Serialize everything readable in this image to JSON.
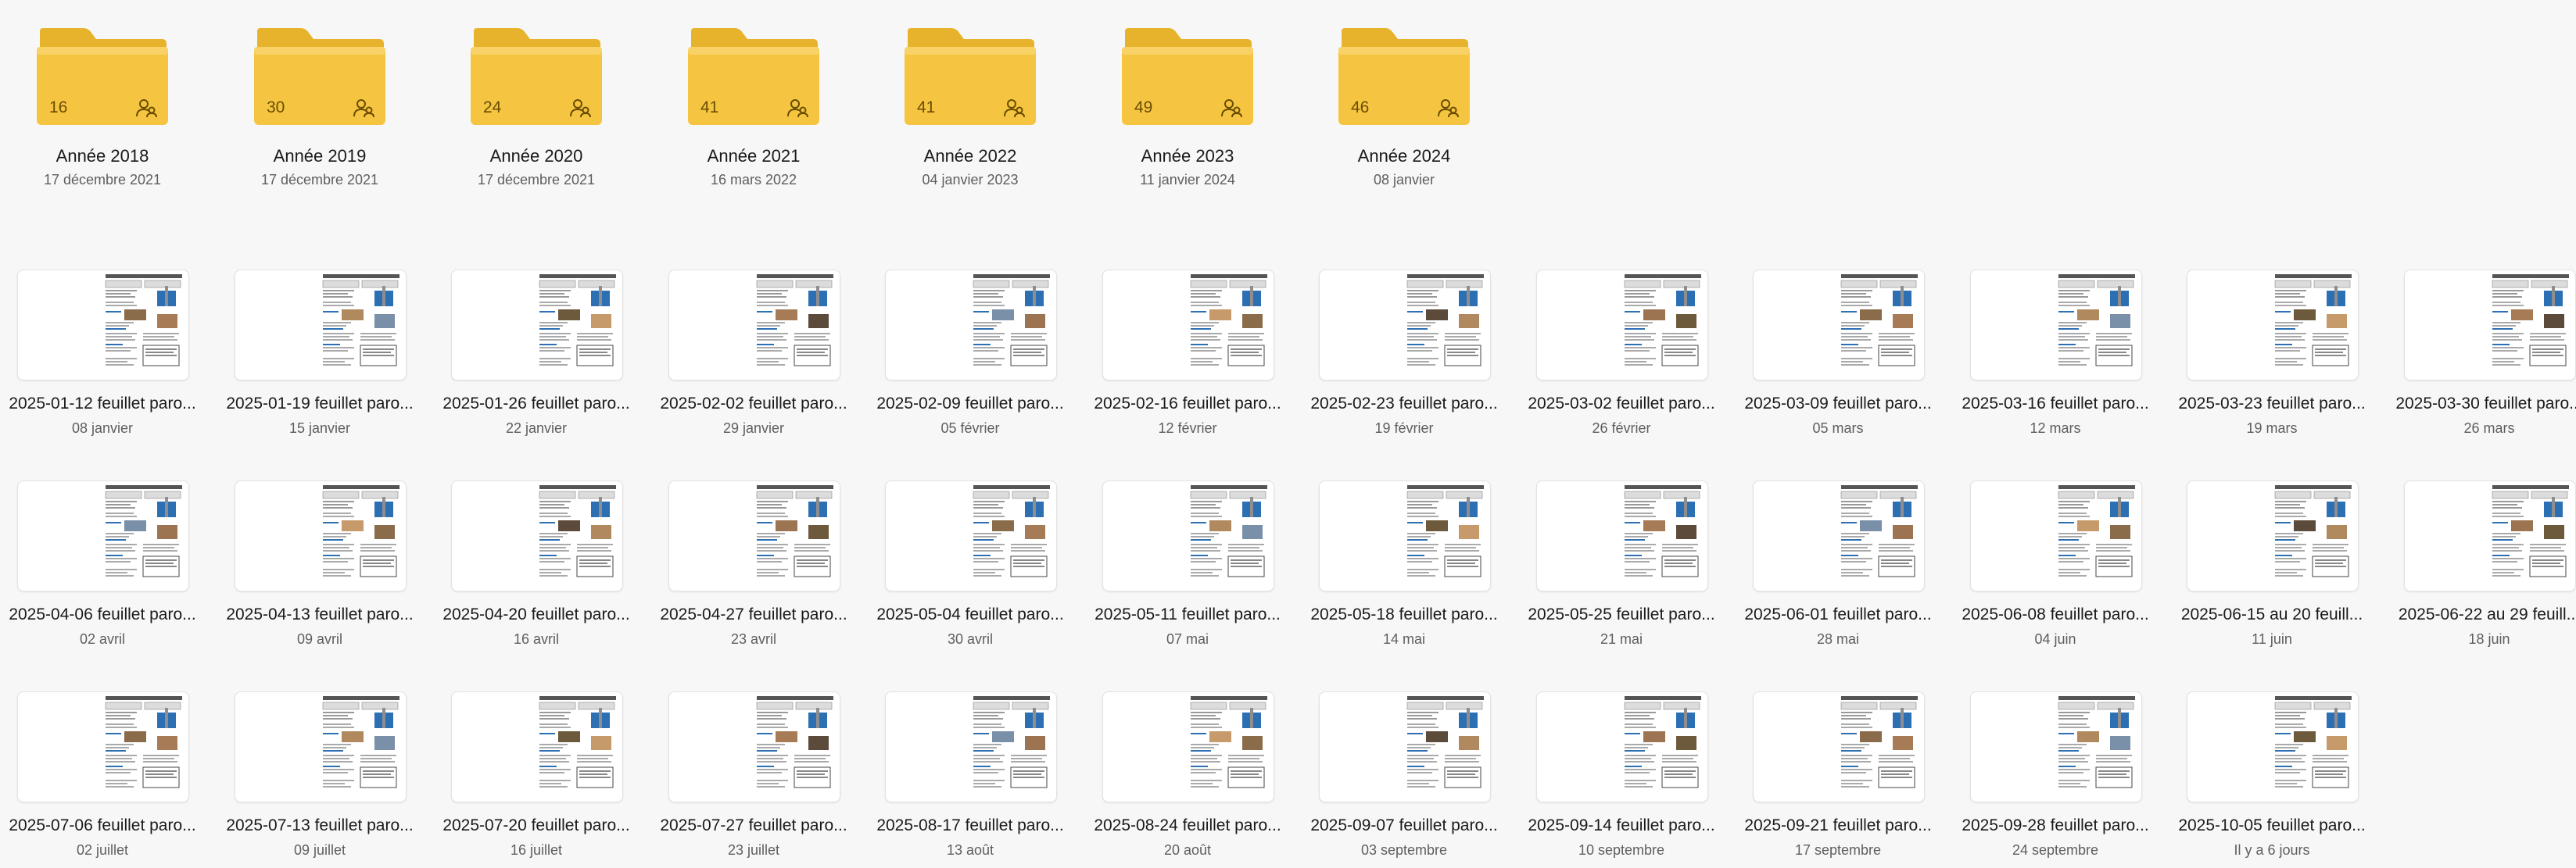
{
  "colors": {
    "folder_body": "#f5c542",
    "folder_tab": "#e8b32c",
    "folder_text": "#6a4d00",
    "background": "#f7f7f7",
    "thumb_accent": "#2c6fb3"
  },
  "icons": {
    "folder": "folder-icon",
    "shared": "shared-people-icon",
    "document": "document-thumbnail"
  },
  "folders": [
    {
      "name": "Année 2018",
      "date": "17 décembre 2021",
      "count": "16"
    },
    {
      "name": "Année 2019",
      "date": "17 décembre 2021",
      "count": "30"
    },
    {
      "name": "Année 2020",
      "date": "17 décembre 2021",
      "count": "24"
    },
    {
      "name": "Année 2021",
      "date": "16 mars 2022",
      "count": "41"
    },
    {
      "name": "Année 2022",
      "date": "04 janvier 2023",
      "count": "41"
    },
    {
      "name": "Année 2023",
      "date": "11 janvier 2024",
      "count": "49"
    },
    {
      "name": "Année 2024",
      "date": "08 janvier",
      "count": "46"
    }
  ],
  "files": [
    {
      "name": "2025-01-12 feuillet paro...",
      "date": "08 janvier"
    },
    {
      "name": "2025-01-19 feuillet paro...",
      "date": "15 janvier"
    },
    {
      "name": "2025-01-26 feuillet paro...",
      "date": "22 janvier"
    },
    {
      "name": "2025-02-02 feuillet paro...",
      "date": "29 janvier"
    },
    {
      "name": "2025-02-09 feuillet paro...",
      "date": "05 février"
    },
    {
      "name": "2025-02-16 feuillet paro...",
      "date": "12 février"
    },
    {
      "name": "2025-02-23 feuillet paro...",
      "date": "19 février"
    },
    {
      "name": "2025-03-02 feuillet paro...",
      "date": "26 février"
    },
    {
      "name": "2025-03-09 feuillet paro...",
      "date": "05 mars"
    },
    {
      "name": "2025-03-16 feuillet paro...",
      "date": "12 mars"
    },
    {
      "name": "2025-03-23 feuillet paro...",
      "date": "19 mars"
    },
    {
      "name": "2025-03-30 feuillet paro...",
      "date": "26 mars"
    },
    {
      "name": "2025-04-06 feuillet paro...",
      "date": "02 avril"
    },
    {
      "name": "2025-04-13 feuillet paro...",
      "date": "09 avril"
    },
    {
      "name": "2025-04-20 feuillet paro...",
      "date": "16 avril"
    },
    {
      "name": "2025-04-27 feuillet paro...",
      "date": "23 avril"
    },
    {
      "name": "2025-05-04 feuillet paro...",
      "date": "30 avril"
    },
    {
      "name": "2025-05-11 feuillet paro...",
      "date": "07 mai"
    },
    {
      "name": "2025-05-18 feuillet paro...",
      "date": "14 mai"
    },
    {
      "name": "2025-05-25 feuillet paro...",
      "date": "21 mai"
    },
    {
      "name": "2025-06-01 feuillet paro...",
      "date": "28 mai"
    },
    {
      "name": "2025-06-08 feuillet paro...",
      "date": "04 juin"
    },
    {
      "name": "2025-06-15 au 20 feuill...",
      "date": "11 juin"
    },
    {
      "name": "2025-06-22 au 29 feuill...",
      "date": "18 juin"
    },
    {
      "name": "2025-07-06 feuillet paro...",
      "date": "02 juillet"
    },
    {
      "name": "2025-07-13 feuillet paro...",
      "date": "09 juillet"
    },
    {
      "name": "2025-07-20 feuillet paro...",
      "date": "16 juillet"
    },
    {
      "name": "2025-07-27 feuillet paro...",
      "date": "23 juillet"
    },
    {
      "name": "2025-08-17 feuillet paro...",
      "date": "13 août"
    },
    {
      "name": "2025-08-24 feuillet paro...",
      "date": "20 août"
    },
    {
      "name": "2025-09-07 feuillet paro...",
      "date": "03 septembre"
    },
    {
      "name": "2025-09-14 feuillet paro...",
      "date": "10 septembre"
    },
    {
      "name": "2025-09-21 feuillet paro...",
      "date": "17 septembre"
    },
    {
      "name": "2025-09-28 feuillet paro...",
      "date": "24 septembre"
    },
    {
      "name": "2025-10-05 feuillet paro...",
      "date": "Il y a 6 jours"
    }
  ]
}
